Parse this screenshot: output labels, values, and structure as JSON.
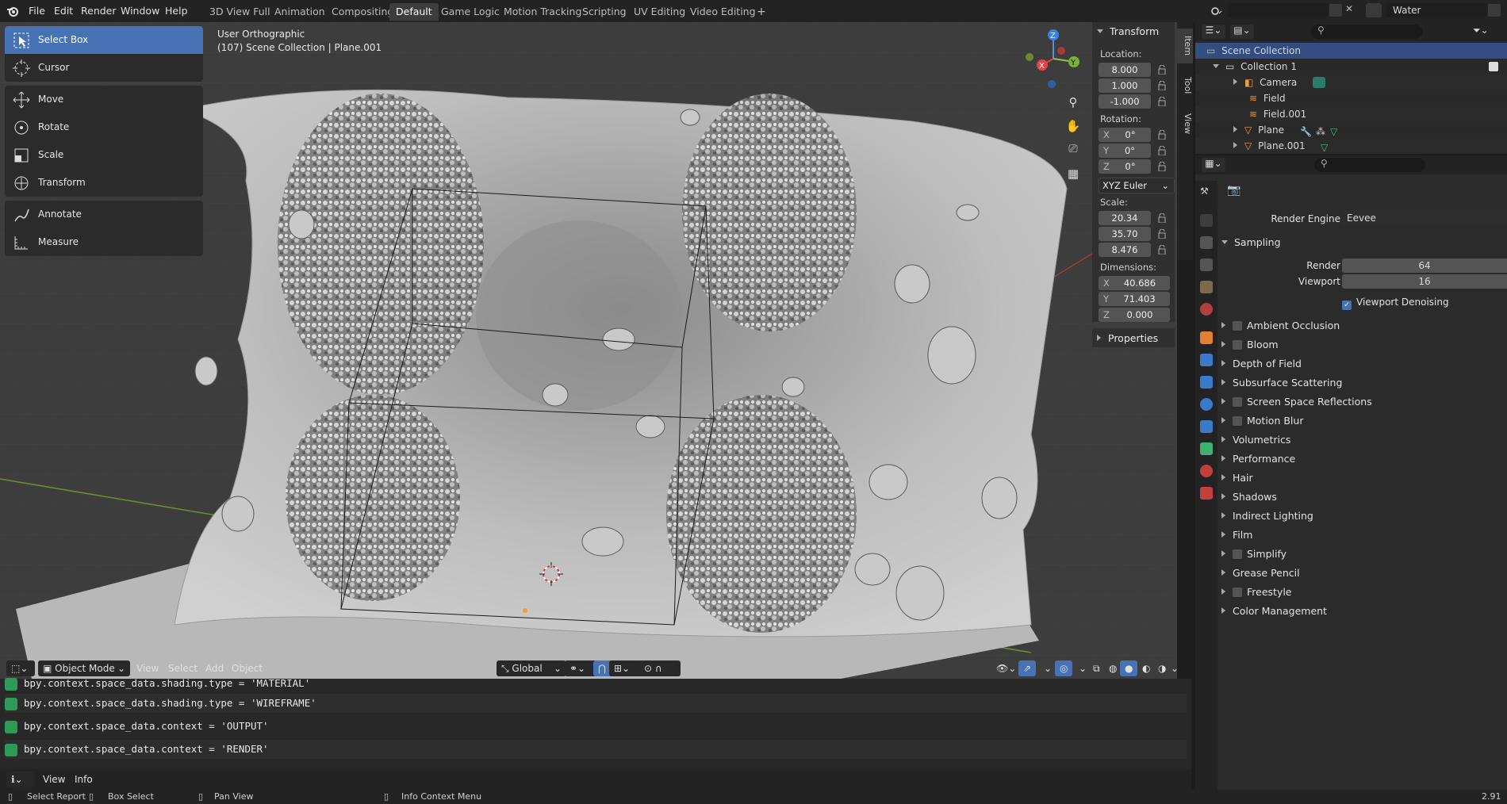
{
  "menus": [
    "File",
    "Edit",
    "Render",
    "Window",
    "Help"
  ],
  "workspaces": [
    {
      "label": "3D View Full",
      "active": false
    },
    {
      "label": "Animation",
      "active": false
    },
    {
      "label": "Compositing",
      "active": false
    },
    {
      "label": "Default",
      "active": true
    },
    {
      "label": "Game Logic",
      "active": false
    },
    {
      "label": "Motion Tracking",
      "active": false
    },
    {
      "label": "Scripting",
      "active": false
    },
    {
      "label": "UV Editing",
      "active": false
    },
    {
      "label": "Video Editing",
      "active": false
    }
  ],
  "add_workspace": "+",
  "scene_field": "",
  "view_layer_field": "Water",
  "tools": {
    "select_box": "Select Box",
    "cursor": "Cursor",
    "move": "Move",
    "rotate": "Rotate",
    "scale": "Scale",
    "transform": "Transform",
    "annotate": "Annotate",
    "measure": "Measure"
  },
  "viewport": {
    "view_name": "User Orthographic",
    "object_path": "(107) Scene Collection | Plane.001",
    "gizmo": {
      "x": "X",
      "y": "Y",
      "z": "Z"
    }
  },
  "viewport_header": {
    "mode": "Object Mode",
    "view": "View",
    "select": "Select",
    "add": "Add",
    "object": "Object",
    "orientation": "Global"
  },
  "npanel": {
    "transform_title": "Transform",
    "location_label": "Location:",
    "location": [
      "8.000",
      "1.000",
      "-1.000"
    ],
    "rotation_label": "Rotation:",
    "rotation": [
      {
        "axis": "X",
        "value": "0°"
      },
      {
        "axis": "Y",
        "value": "0°"
      },
      {
        "axis": "Z",
        "value": "0°"
      }
    ],
    "rotation_mode": "XYZ Euler",
    "scale_label": "Scale:",
    "scale": [
      "20.34",
      "35.70",
      "8.476"
    ],
    "dimensions_label": "Dimensions:",
    "dimensions": [
      {
        "axis": "X",
        "value": "40.686"
      },
      {
        "axis": "Y",
        "value": "71.403"
      },
      {
        "axis": "Z",
        "value": "0.000"
      }
    ],
    "properties_title": "Properties",
    "tabs": [
      "Item",
      "Tool",
      "View"
    ]
  },
  "info_log": [
    "bpy.context.space_data.shading.type = 'MATERIAL'",
    "bpy.context.space_data.shading.type = 'WIREFRAME'",
    "bpy.context.space_data.context = 'OUTPUT'",
    "bpy.context.space_data.context = 'RENDER'"
  ],
  "info_header": {
    "view": "View",
    "info": "Info"
  },
  "statusbar": {
    "select": "Select Report",
    "box": "Box Select",
    "pan": "Pan View",
    "context": "Info Context Menu",
    "version": "2.91"
  },
  "outliner": {
    "rows": [
      {
        "label": "Scene Collection",
        "selected": true
      },
      {
        "label": "Collection 1"
      },
      {
        "label": "Camera"
      },
      {
        "label": "Field"
      },
      {
        "label": "Field.001"
      },
      {
        "label": "Plane"
      },
      {
        "label": "Plane.001"
      }
    ]
  },
  "properties": {
    "render_engine_label": "Render Engine",
    "render_engine": "Eevee",
    "sampling": "Sampling",
    "render_label": "Render",
    "render_value": "64",
    "viewport_label": "Viewport",
    "viewport_value": "16",
    "viewport_denoising": "Viewport Denoising",
    "panels": [
      {
        "label": "Ambient Occlusion",
        "checkbox": true
      },
      {
        "label": "Bloom",
        "checkbox": true
      },
      {
        "label": "Depth of Field",
        "checkbox": false
      },
      {
        "label": "Subsurface Scattering",
        "checkbox": false
      },
      {
        "label": "Screen Space Reflections",
        "checkbox": true
      },
      {
        "label": "Motion Blur",
        "checkbox": true
      },
      {
        "label": "Volumetrics",
        "checkbox": false
      },
      {
        "label": "Performance",
        "checkbox": false
      },
      {
        "label": "Hair",
        "checkbox": false
      },
      {
        "label": "Shadows",
        "checkbox": false
      },
      {
        "label": "Indirect Lighting",
        "checkbox": false
      },
      {
        "label": "Film",
        "checkbox": false
      },
      {
        "label": "Simplify",
        "checkbox": true
      },
      {
        "label": "Grease Pencil",
        "checkbox": false
      },
      {
        "label": "Freestyle",
        "checkbox": true
      },
      {
        "label": "Color Management",
        "checkbox": false
      }
    ]
  },
  "colors": {
    "accent": "#4772b3",
    "selected_row": "#334d80",
    "green_icon": "#2e9a5a"
  }
}
